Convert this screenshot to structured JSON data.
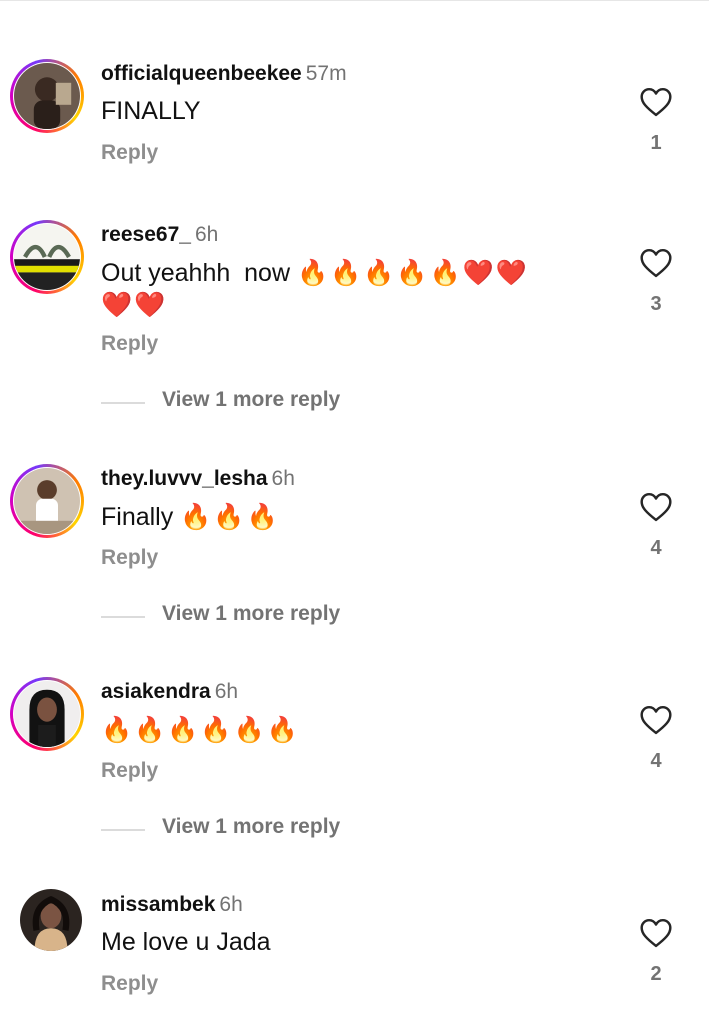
{
  "comments": [
    {
      "username": "officialqueenbeekee",
      "time": "57m",
      "text": "FINALLY",
      "emoji": "",
      "reply": "Reply",
      "likes": "1",
      "view_more": ""
    },
    {
      "username": "reese67_",
      "time": "6h",
      "text": "Out yeahhh  now ",
      "emoji": "🔥🔥🔥🔥🔥❤️❤️\n❤️❤️",
      "reply": "Reply",
      "likes": "3",
      "view_more": "View 1 more reply"
    },
    {
      "username": "they.luvvv_lesha",
      "time": "6h",
      "text": "Finally ",
      "emoji": "🔥🔥🔥",
      "reply": "Reply",
      "likes": "4",
      "view_more": "View 1 more reply"
    },
    {
      "username": "asiakendra",
      "time": "6h",
      "text": "",
      "emoji": "🔥🔥🔥🔥🔥🔥",
      "reply": "Reply",
      "likes": "4",
      "view_more": "View 1 more reply"
    },
    {
      "username": "missambek",
      "time": "6h",
      "text": "Me love u Jada",
      "emoji": "",
      "reply": "Reply",
      "likes": "2",
      "view_more": ""
    }
  ]
}
